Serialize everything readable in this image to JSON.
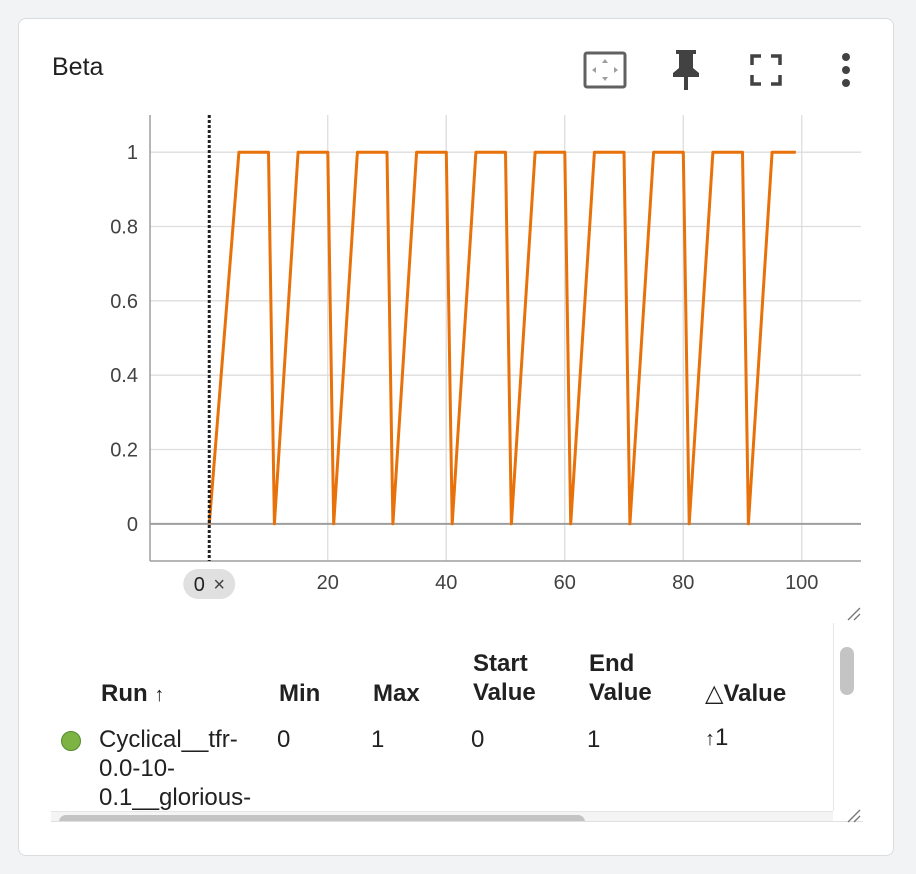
{
  "card": {
    "title": "Beta",
    "toolbar": {
      "fit_icon": "fit-to-data-icon",
      "pin_icon": "pin-icon",
      "fullscreen_icon": "fullscreen-icon",
      "more_icon": "more-vert-icon"
    }
  },
  "chart_data": {
    "type": "line",
    "title": "Beta",
    "xlabel": "",
    "ylabel": "",
    "xlim": [
      -10,
      110
    ],
    "ylim": [
      -0.1,
      1.1
    ],
    "x_ticks": [
      20,
      40,
      60,
      80,
      100
    ],
    "y_ticks": [
      0,
      0.2,
      0.4,
      0.6,
      0.8,
      1
    ],
    "y_tick_labels": [
      "0",
      "0.2",
      "0.4",
      "0.6",
      "0.8",
      "1"
    ],
    "grid": true,
    "x_origin_chip": "0",
    "chip_close_glyph": "×",
    "line_color": "#e8710a",
    "series": [
      {
        "color": "#e8710a",
        "x": [
          0,
          5,
          10,
          11,
          15,
          20,
          21,
          25,
          30,
          31,
          35,
          40,
          41,
          45,
          50,
          51,
          55,
          60,
          61,
          65,
          70,
          71,
          75,
          80,
          81,
          85,
          90,
          91,
          95,
          99
        ],
        "y": [
          0,
          1,
          1,
          0,
          1,
          1,
          0,
          1,
          1,
          0,
          1,
          1,
          0,
          1,
          1,
          0,
          1,
          1,
          0,
          1,
          1,
          0,
          1,
          1,
          0,
          1,
          1,
          0,
          1,
          1
        ]
      }
    ]
  },
  "table": {
    "columns": {
      "run": "Run",
      "run_sort_glyph": "↑",
      "min": "Min",
      "max": "Max",
      "start_value_1": "Start",
      "start_value_2": "Value",
      "end_value_1": "End",
      "end_value_2": "Value",
      "delta_glyph": "△",
      "delta_label": "Value"
    },
    "rows": [
      {
        "run_color": "#7cb342",
        "run_line1": "Cyclical__tfr-",
        "run_line2": "0.0-10-",
        "run_line3": "0.1__glorious-",
        "min": "0",
        "max": "1",
        "start": "0",
        "end": "1",
        "delta_glyph": "↑",
        "delta": "1"
      }
    ]
  }
}
